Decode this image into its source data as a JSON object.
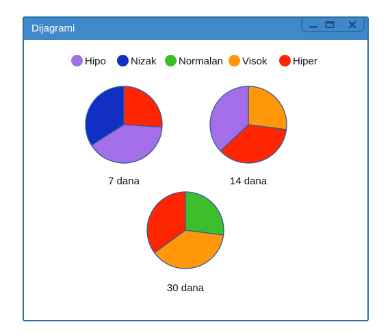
{
  "window": {
    "title": "Dijagrami"
  },
  "legend": [
    {
      "name": "Hipo",
      "color": "#a46ee8"
    },
    {
      "name": "Nizak",
      "color": "#122fc4"
    },
    {
      "name": "Normalan",
      "color": "#3cbf2a"
    },
    {
      "name": "Visok",
      "color": "#ff9708"
    },
    {
      "name": "Hiper",
      "color": "#ff2500"
    }
  ],
  "chart_data": [
    {
      "type": "pie",
      "title": "7 dana",
      "labels": [
        "Hiper",
        "Hipo",
        "Nizak"
      ],
      "values": [
        26,
        40,
        34
      ],
      "colors": [
        "#ff2500",
        "#a46ee8",
        "#122fc4"
      ]
    },
    {
      "type": "pie",
      "title": "14 dana",
      "labels": [
        "Visok",
        "Hiper",
        "Hipo"
      ],
      "values": [
        27,
        36,
        37
      ],
      "colors": [
        "#ff9708",
        "#ff2500",
        "#a46ee8"
      ]
    },
    {
      "type": "pie",
      "title": "30 dana",
      "labels": [
        "Normalan",
        "Visok",
        "Hiper"
      ],
      "values": [
        27,
        38,
        35
      ],
      "colors": [
        "#3cbf2a",
        "#ff9708",
        "#ff2500"
      ]
    }
  ]
}
